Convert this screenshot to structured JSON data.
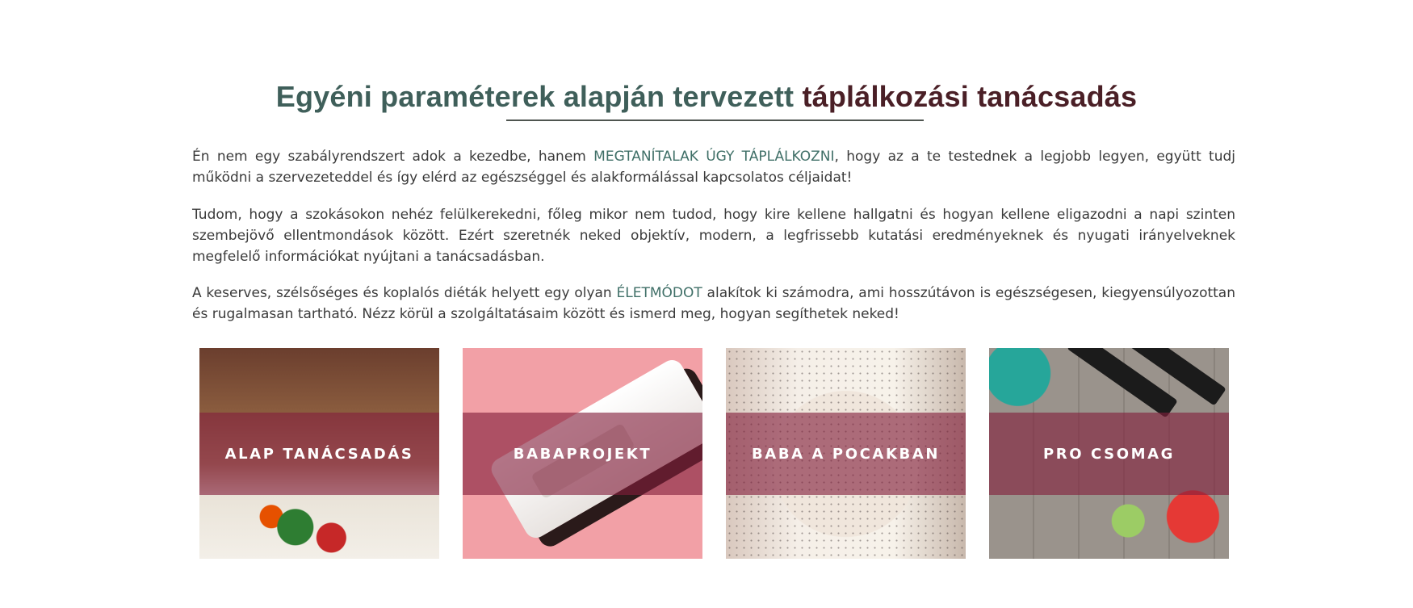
{
  "heading": {
    "part_a": "Egyéni paraméterek alapján tervezett",
    "part_b": "táplálkozási tanácsadás"
  },
  "paragraphs": {
    "p1_start": "Én nem egy szabályrendszert adok a kezedbe, hanem ",
    "p1_highlight": "MEGTANÍTALAK ÚGY TÁPLÁLKOZNI",
    "p1_end": ", hogy az a te testednek a legjobb legyen, együtt tudj működni a szervezeteddel és így elérd az egészséggel és alakformálással kapcsolatos céljaidat!",
    "p2": "Tudom, hogy a szokásokon nehéz felülkerekedni, főleg mikor nem tudod, hogy kire kellene hallgatni és hogyan kellene eligazodni a napi szinten szembejövő ellentmondások között. Ezért szeretnék neked objektív, modern, a legfrissebb kutatási eredményeknek és nyugati irányelveknek megfelelő információkat nyújtani a tanácsadásban.",
    "p3_start": "A keserves, szélsőséges és koplalós diéták helyett egy olyan ",
    "p3_highlight": "ÉLETMÓDOT",
    "p3_end": " alakítok ki számodra, ami hosszútávon is egészségesen, kiegyensúlyozottan és rugalmasan tartható. Nézz körül a szolgáltatásaim között és ismerd meg, hogyan segíthetek neked!"
  },
  "cards": [
    {
      "label": "ALAP TANÁCSADÁS"
    },
    {
      "label": "BABAPROJEKT"
    },
    {
      "label": "BABA A POCAKBAN"
    },
    {
      "label": "PRO CSOMAG"
    }
  ],
  "colors": {
    "heading_teal": "#3f5f5a",
    "heading_burgundy": "#4a1f26",
    "highlight": "#3f6f67",
    "overlay": "#821e3c"
  }
}
